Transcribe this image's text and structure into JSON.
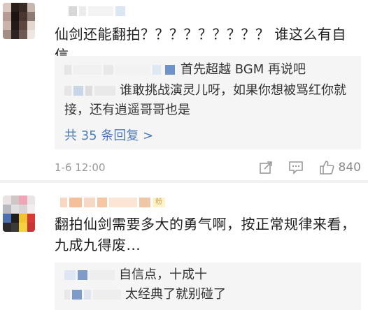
{
  "comments": [
    {
      "text": "仙剑还能翻拍？？？？？？？？？ 谁这么有自信",
      "replies": [
        {
          "text": "首先超越 BGM 再说吧"
        },
        {
          "text": "谁敢挑战演灵儿呀，如果你想被骂红你就接，还有逍遥哥哥也是"
        }
      ],
      "more_replies_label": "共 35 条回复 >",
      "timestamp": "1-6 12:00",
      "like_count": "840"
    },
    {
      "badge": "粉",
      "text": "翻拍仙剑需要多大的勇气啊，按正常规律来看，九成九得废...",
      "replies": [
        {
          "text": "自信点，十成十"
        },
        {
          "text": "太经典了就别碰了"
        }
      ]
    }
  ],
  "colors": {
    "link": "#4f7cb8",
    "reply_bg": "#f5f5f5",
    "meta": "#9a9a9a"
  },
  "icons": [
    "share-icon",
    "comment-icon",
    "thumbs-up-icon"
  ]
}
